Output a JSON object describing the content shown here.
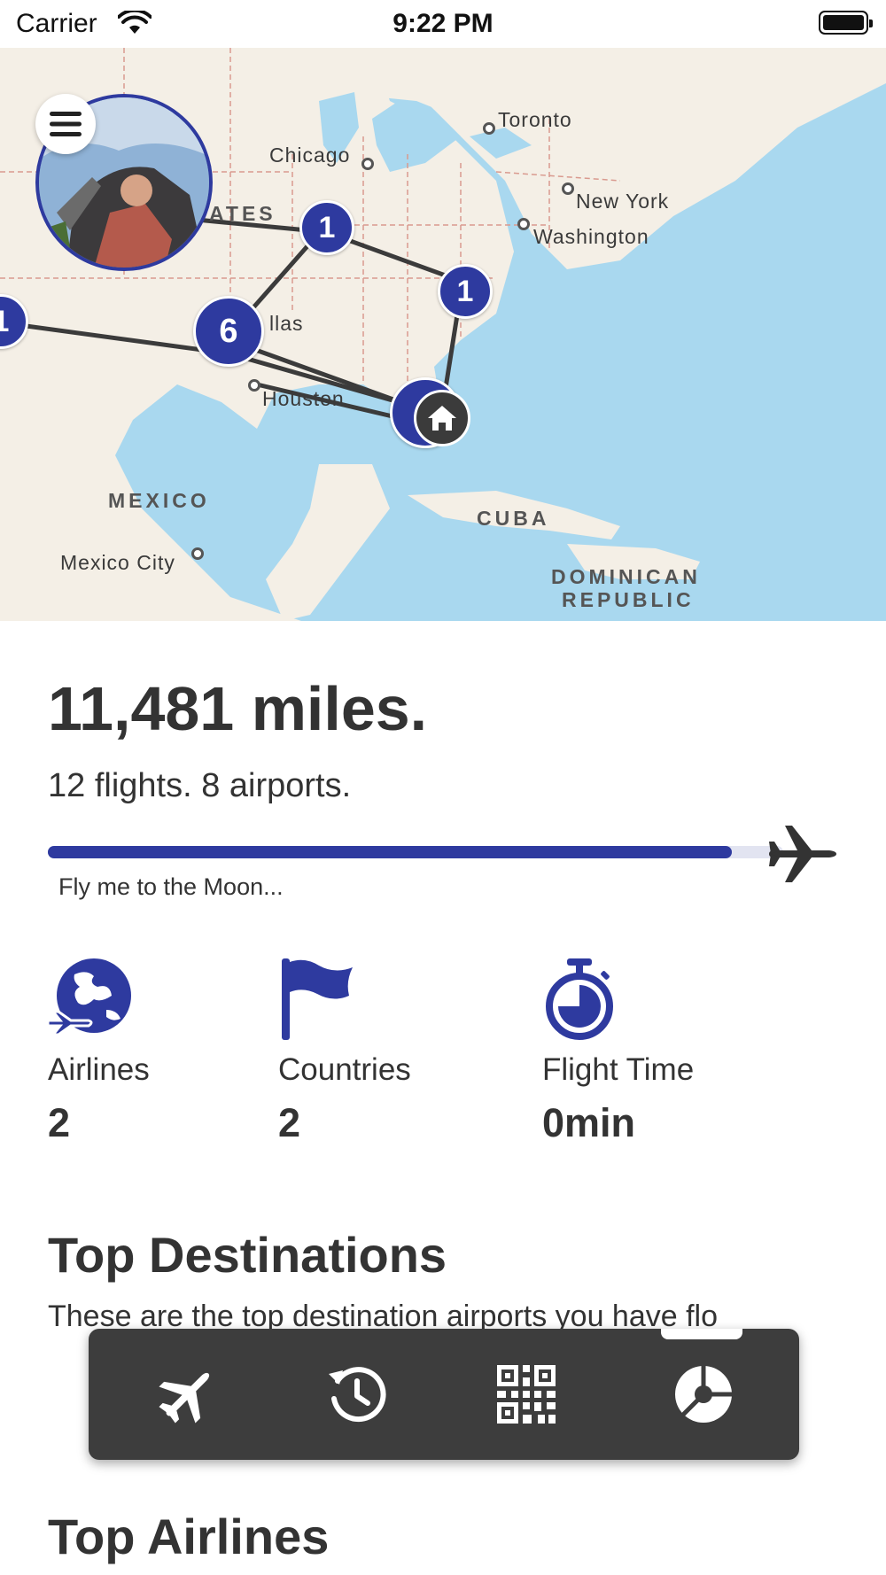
{
  "status_bar": {
    "carrier": "Carrier",
    "time": "9:22 PM"
  },
  "map": {
    "labels": {
      "toronto": "Toronto",
      "chicago": "Chicago",
      "new_york": "New York",
      "washington": "Washington",
      "states_fragment": "ATES",
      "dallas_fragment": "llas",
      "houston": "Houston",
      "mexico": "MEXICO",
      "mexico_city": "Mexico City",
      "cuba": "CUBA",
      "dominican_1": "DOMINICAN",
      "dominican_2": "REPUBLIC"
    },
    "clusters": {
      "c1": "1",
      "c2": "1",
      "c3": "6",
      "c4": "1"
    },
    "colors": {
      "accent": "#2e3a9f",
      "water": "#a9d8ef",
      "land": "#f4efe6"
    }
  },
  "summary": {
    "miles": "11,481 miles.",
    "subline": "12 flights. 8 airports.",
    "progress_caption": "Fly me to the Moon...",
    "progress_fraction": 0.93
  },
  "stats": [
    {
      "icon": "globe-plane-icon",
      "label": "Airlines",
      "value": "2"
    },
    {
      "icon": "flag-icon",
      "label": "Countries",
      "value": "2"
    },
    {
      "icon": "stopwatch-icon",
      "label": "Flight Time",
      "value": "0min"
    }
  ],
  "top_destinations": {
    "title": "Top Destinations",
    "description": "These are the top destination airports you have flo"
  },
  "top_airlines": {
    "title": "Top Airlines"
  },
  "tab_bar": {
    "tabs": [
      {
        "icon": "airplane-icon"
      },
      {
        "icon": "history-icon"
      },
      {
        "icon": "qr-code-icon"
      },
      {
        "icon": "pie-chart-icon"
      }
    ]
  }
}
